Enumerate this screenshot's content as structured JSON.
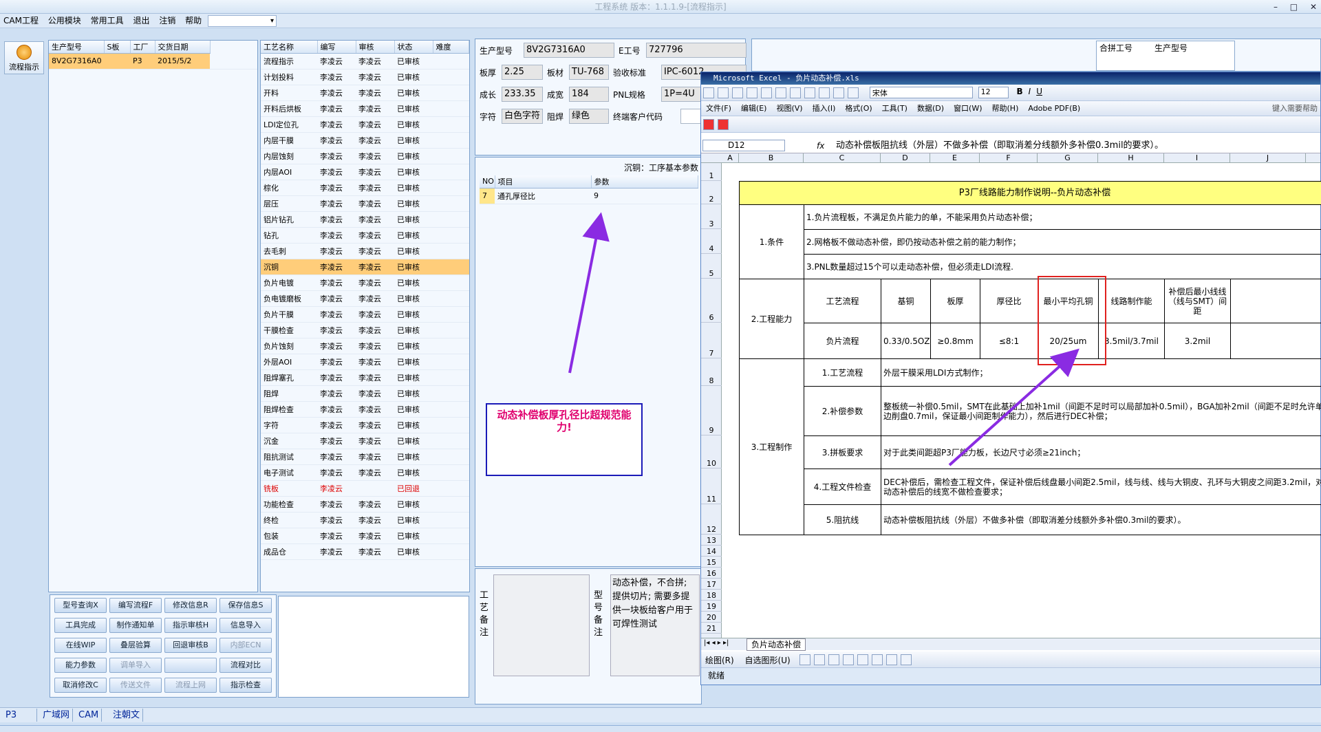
{
  "app": {
    "title": "工程系统 版本：1.1.1.9-[流程指示]"
  },
  "menubar": {
    "items": [
      "CAM工程",
      "公用模块",
      "常用工具",
      "退出",
      "注销",
      "帮助"
    ]
  },
  "window_controls": {
    "minimize": "–",
    "restore": "□",
    "close": "✕"
  },
  "left_tool": {
    "flow_label": "流程指示"
  },
  "order_list": {
    "headers": [
      "生产型号",
      "S板",
      "工厂",
      "交货日期"
    ],
    "rows": [
      {
        "model": "8V2G7316A0",
        "s": "",
        "factory": "P3",
        "date": "2015/5/2"
      }
    ]
  },
  "process_list": {
    "headers": [
      "工艺名称",
      "编写",
      "审核",
      "状态",
      "难度"
    ],
    "rows": [
      [
        "流程指示",
        "李凌云",
        "李凌云",
        "已审核"
      ],
      [
        "计划投料",
        "李凌云",
        "李凌云",
        "已审核"
      ],
      [
        "开料",
        "李凌云",
        "李凌云",
        "已审核"
      ],
      [
        "开料后烘板",
        "李凌云",
        "李凌云",
        "已审核"
      ],
      [
        "LDI定位孔",
        "李凌云",
        "李凌云",
        "已审核"
      ],
      [
        "内层干膜",
        "李凌云",
        "李凌云",
        "已审核"
      ],
      [
        "内层蚀刻",
        "李凌云",
        "李凌云",
        "已审核"
      ],
      [
        "内层AOI",
        "李凌云",
        "李凌云",
        "已审核"
      ],
      [
        "棕化",
        "李凌云",
        "李凌云",
        "已审核"
      ],
      [
        "层压",
        "李凌云",
        "李凌云",
        "已审核"
      ],
      [
        "铝片钻孔",
        "李凌云",
        "李凌云",
        "已审核"
      ],
      [
        "钻孔",
        "李凌云",
        "李凌云",
        "已审核"
      ],
      [
        "去毛刺",
        "李凌云",
        "李凌云",
        "已审核"
      ],
      [
        "沉铜",
        "李凌云",
        "李凌云",
        "已审核"
      ],
      [
        "负片电镀",
        "李凌云",
        "李凌云",
        "已审核"
      ],
      [
        "负电镀磨板",
        "李凌云",
        "李凌云",
        "已审核"
      ],
      [
        "负片干膜",
        "李凌云",
        "李凌云",
        "已审核"
      ],
      [
        "干膜检查",
        "李凌云",
        "李凌云",
        "已审核"
      ],
      [
        "负片蚀刻",
        "李凌云",
        "李凌云",
        "已审核"
      ],
      [
        "外层AOI",
        "李凌云",
        "李凌云",
        "已审核"
      ],
      [
        "阻焊塞孔",
        "李凌云",
        "李凌云",
        "已审核"
      ],
      [
        "阻焊",
        "李凌云",
        "李凌云",
        "已审核"
      ],
      [
        "阻焊检查",
        "李凌云",
        "李凌云",
        "已审核"
      ],
      [
        "字符",
        "李凌云",
        "李凌云",
        "已审核"
      ],
      [
        "沉金",
        "李凌云",
        "李凌云",
        "已审核"
      ],
      [
        "阻抗测试",
        "李凌云",
        "李凌云",
        "已审核"
      ],
      [
        "电子测试",
        "李凌云",
        "李凌云",
        "已审核"
      ],
      [
        "铣板",
        "李凌云",
        "",
        "已回退"
      ],
      [
        "功能检查",
        "李凌云",
        "李凌云",
        "已审核"
      ],
      [
        "终检",
        "李凌云",
        "李凌云",
        "已审核"
      ],
      [
        "包装",
        "李凌云",
        "李凌云",
        "已审核"
      ],
      [
        "成品仓",
        "李凌云",
        "李凌云",
        "已审核"
      ]
    ]
  },
  "buttons": [
    "型号查询X",
    "编写流程F",
    "修改信息R",
    "保存信息S",
    "工具完成",
    "制作通知单",
    "指示审核H",
    "信息导入",
    "在线WIP",
    "叠层验算",
    "回退审核B",
    "内部ECN",
    "能力参数",
    "调单导入",
    "",
    "流程对比",
    "取消修改C",
    "传送文件",
    "流程上网",
    "指示检查"
  ],
  "info": {
    "model_label": "生产型号",
    "model": "8V2G7316A0",
    "eno_label": "E工号",
    "eno": "727796",
    "thick_label": "板厚",
    "thick": "2.25",
    "material_label": "板材",
    "material": "TU-768",
    "std_label": "验收标准",
    "std": "IPC-6012 ",
    "len_label": "成长",
    "len": "233.35",
    "wid_label": "成宽",
    "wid": "184",
    "pnl_label": "PNL规格",
    "pnl": "1P=4U",
    "char_label": "字符",
    "char": "白色字符",
    "mask_label": "阻焊",
    "mask": "绿色",
    "cust_label": "终端客户代码",
    "combo_label": "合拼工号",
    "combo_model_label": "生产型号"
  },
  "params": {
    "title": "沉铜：工序基本参数",
    "headers": [
      "NO",
      "项目",
      "参数"
    ],
    "rows": [
      {
        "no": "7",
        "item": "通孔厚径比",
        "value": "9"
      }
    ]
  },
  "callout": {
    "text": "动态补偿板厚孔径比超规范能力!"
  },
  "notes": {
    "process_label": "工艺备注",
    "model_label": "型号备注",
    "model_note": "动态补偿，不合拼; 提供切片; 需要多提供一块板给客户用于可焊性测试"
  },
  "status_tabs": [
    "P3",
    "广域网",
    "CAM",
    "注朝文"
  ],
  "excel": {
    "title": "Microsoft Excel - 负片动态补偿.xls",
    "menu": [
      "文件(F)",
      "编辑(E)",
      "视图(V)",
      "插入(I)",
      "格式(O)",
      "工具(T)",
      "数据(D)",
      "窗口(W)",
      "帮助(H)",
      "Adobe PDF(B)"
    ],
    "help_box": "键入需要帮助",
    "font": "宋体",
    "size": "12",
    "cell_ref": "D12",
    "formula": "动态补偿板阻抗线（外层）不做多补偿（即取消差分线额外多补偿0.3mil的要求）。",
    "columns": [
      "A",
      "B",
      "C",
      "D",
      "E",
      "F",
      "G",
      "H",
      "I",
      "J"
    ],
    "rows": [
      "1",
      "2",
      "3",
      "4",
      "5",
      "6",
      "7",
      "8",
      "9",
      "10",
      "11",
      "12",
      "13",
      "14",
      "15",
      "16",
      "17",
      "18",
      "19",
      "20",
      "21"
    ],
    "sheet_title": "P3厂线路能力制作说明--负片动态补偿",
    "cond_label": "1.条件",
    "cond": [
      "1.负片流程板，不满足负片能力的单，不能采用负片动态补偿；",
      "2.网格板不做动态补偿，即仍按动态补偿之前的能力制作；",
      "3.PNL数量超过15个可以走动态补偿，但必须走LDI流程."
    ],
    "cap_label": "2.工程能力",
    "cap_headers": [
      "工艺流程",
      "基铜",
      "板厚",
      "厚径比",
      "最小平均孔铜",
      "线路制作能",
      "补偿后最小线线（线与SMT）间距"
    ],
    "cap_values": [
      "负片流程",
      "0.33/0.5OZ",
      "≥0.8mm",
      "≤8:1",
      "20/25um",
      "3.5mil/3.7mil",
      "3.2mil"
    ],
    "make_label": "3.工程制作",
    "make_items": [
      {
        "k": "1.工艺流程",
        "v": "外层干膜采用LDI方式制作；"
      },
      {
        "k": "2.补偿参数",
        "v": "整板统一补偿0.5mil，SMT在此基础上加补1mil（间距不足时可以局部加补0.5mil），BGA加补2mil（间距不足时允许单边削盘0.7mil，保证最小间距制作能力），然后进行DEC补偿；"
      },
      {
        "k": "3.拼板要求",
        "v": "对于此类间距超P3厂能力板，长边尺寸必须≥21inch；"
      },
      {
        "k": "4.工程文件检查",
        "v": "DEC补偿后，需检查工程文件，保证补偿后线盘最小间距2.5mil，线与线、线与大铜皮、孔环与大铜皮之间距3.2mil，对动态补偿后的线宽不做检查要求；"
      },
      {
        "k": "5.阻抗线",
        "v": "动态补偿板阻抗线（外层）不做多补偿（即取消差分线额外多补偿0.3mil的要求）。"
      }
    ],
    "tab": "负片动态补偿",
    "draw_label": "绘图(R)",
    "autoshape": "自选图形(U)",
    "status": "就绪"
  },
  "colors": {
    "accent": "#ffcd7a",
    "arrow": "#8a2be2",
    "callout_border": "#1a1ab8",
    "callout_text": "#e0006e",
    "highlight": "#e0201e"
  }
}
